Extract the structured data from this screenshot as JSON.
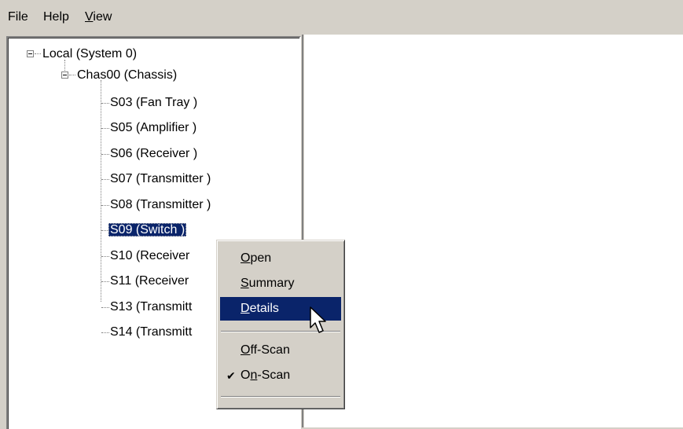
{
  "menubar": {
    "file": "File",
    "help": "Help",
    "view_first": "V",
    "view_rest": "iew"
  },
  "tree": {
    "root": "Local (System 0)",
    "chassis": "Chas00 (Chassis)",
    "slots": [
      "S03 (Fan Tray )",
      "S05 (Amplifier )",
      "S06 (Receiver )",
      "S07 (Transmitter )",
      "S08 (Transmitter )",
      "S09 (Switch )",
      "S10 (Receiver",
      "S11 (Receiver",
      "S13 (Transmitt",
      "S14 (Transmitt"
    ],
    "selected_index": 5
  },
  "context_menu": {
    "open": {
      "mnemonic": "O",
      "rest": "pen"
    },
    "summary": {
      "mnemonic": "S",
      "rest": "ummary"
    },
    "details": {
      "mnemonic": "D",
      "rest": "etails"
    },
    "off_scan": {
      "mnemonic": "O",
      "rest": "ff-Scan"
    },
    "on_scan": {
      "pre": "O",
      "mnemonic": "n",
      "rest": "-Scan"
    },
    "checked_item": "On-Scan",
    "highlighted_item": "Details",
    "check_glyph": "✔"
  },
  "icons": {
    "collapse": "minus-box-icon",
    "cursor": "arrow-cursor-icon"
  }
}
